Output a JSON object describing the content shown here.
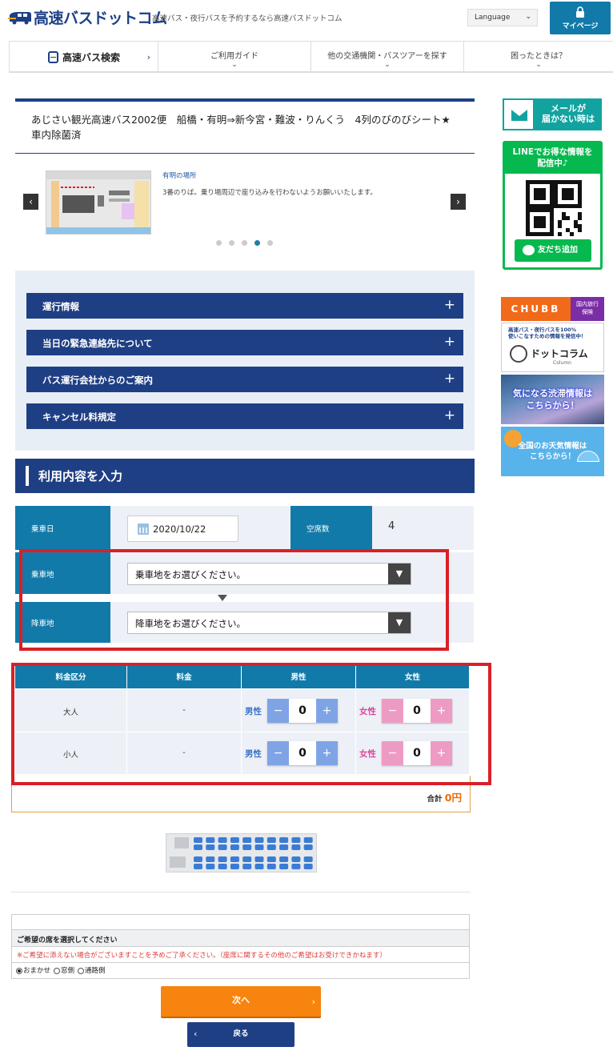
{
  "header": {
    "logo_text": "高速バスドットコム",
    "tagline": "高速バス・夜行バスを予約するなら高速バスドットコム",
    "language": "Language",
    "mypage": "マイページ"
  },
  "nav": {
    "items": [
      {
        "label": "高速バス検索"
      },
      {
        "label": "ご利用ガイド"
      },
      {
        "label": "他の交通機関・バスツアーを探す"
      },
      {
        "label": "困ったときは？"
      }
    ]
  },
  "title": "あじさい観光高速バス2002便　船橋・有明⇒新今宮・難波・りんくう　4列のびのびシート★車内除菌済",
  "slider": {
    "caption_title": "有明の場所",
    "caption_text": "3番のりば。乗り場周辺で座り込みを行わないようお願いいたします。",
    "dot_count": 5,
    "active_dot": 4
  },
  "accordion": {
    "items": [
      {
        "label": "運行情報"
      },
      {
        "label": "当日の緊急連絡先について"
      },
      {
        "label": "バス運行会社からのご案内"
      },
      {
        "label": "キャンセル料規定"
      }
    ]
  },
  "form": {
    "section_title": "利用内容を入力",
    "date_label": "乗車日",
    "date_value": "2020/10/22",
    "vacancy_label": "空席数",
    "vacancy_value": "4",
    "boarding_label": "乗車地",
    "boarding_placeholder": "乗車地をお選びください。",
    "alighting_label": "降車地",
    "alighting_placeholder": "降車地をお選びください。"
  },
  "fare": {
    "headers": [
      "料金区分",
      "料金",
      "男性",
      "女性"
    ],
    "rows": [
      {
        "category": "大人",
        "price": "-",
        "male_label": "男性",
        "male_count": "0",
        "female_label": "女性",
        "female_count": "0"
      },
      {
        "category": "小人",
        "price": "-",
        "male_label": "男性",
        "male_count": "0",
        "female_label": "女性",
        "female_count": "0"
      }
    ],
    "minus": "−",
    "plus": "+",
    "total_label": "合計",
    "total_amount": "0円"
  },
  "seat_pref": {
    "title": "ご希望の席を選択してください",
    "note": "※ご希望に添えない場合がございますことを予めご了承ください。（座席に関するその他のご希望はお受けできかねます）",
    "options": [
      "おまかせ",
      "窓側",
      "通路側"
    ],
    "selected": "おまかせ"
  },
  "buttons": {
    "next": "次へ",
    "back": "戻る"
  },
  "sidebar": {
    "mail": "メールが\n届かない時は",
    "line_header": "LINEでお得な情報を\n配信中♪",
    "line_add": "友だち追加",
    "chubb": "CHUBB",
    "chubb_sub": "国内旅行\n保険",
    "column_text": "高速バス・夜行バスを100%\n使いこなすための情報を発信中！",
    "column_title": "ドットコラム",
    "column_sub": "Column",
    "traffic": "気になる渋滞情報は\nこちらから！",
    "weather": "全国のお天気情報は\nこちらから！"
  },
  "colors": {
    "navy": "#1f3f84",
    "teal": "#127aa8",
    "highlight_red": "#d92027",
    "orange": "#f7840f",
    "line_green": "#06b94e"
  }
}
